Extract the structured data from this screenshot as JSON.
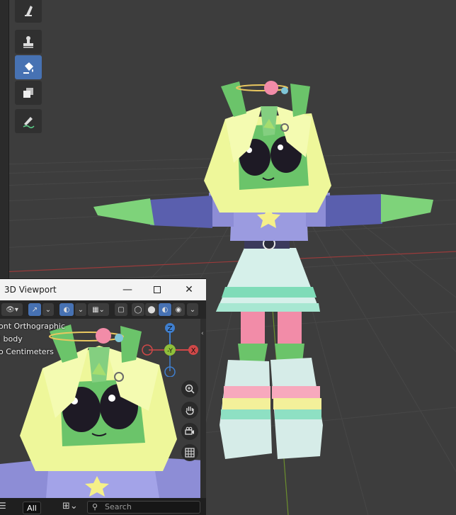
{
  "toolbar": {
    "tools": [
      {
        "name": "smear-tool",
        "icon": "smear-icon",
        "active": false
      },
      {
        "name": "clone-tool",
        "icon": "stamp-icon",
        "active": false
      },
      {
        "name": "fill-tool",
        "icon": "fill-bucket-icon",
        "active": true
      },
      {
        "name": "mask-tool",
        "icon": "mask-icon",
        "active": false
      },
      {
        "name": "annotate-tool",
        "icon": "annotate-pencil-icon",
        "active": false
      }
    ]
  },
  "mini_window": {
    "title": "3D Viewport",
    "overlay": {
      "view_name": "ont Orthographic",
      "object_name": "l body",
      "units": "o Centimeters"
    },
    "gizmo": {
      "z": "Z",
      "y": "-Y",
      "x": "X"
    },
    "footer": {
      "all_label": "All",
      "search_placeholder": "Search"
    }
  },
  "colors": {
    "viewport_bg": "#3d3d3d",
    "active_tool": "#4772b3",
    "axis_x": "#d04848",
    "axis_y": "#8fbf3a",
    "axis_z": "#3f7fcf",
    "skin": "#6bc46a",
    "hair": "#eef79a",
    "shirt": "#9b9be0",
    "skirt": "#d6f0ea",
    "mint": "#7fdcb8",
    "pink": "#f28ca8"
  }
}
